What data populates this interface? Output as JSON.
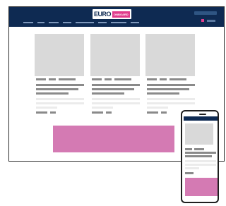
{
  "desktop": {
    "logo_text": "EURO",
    "logo_tag": "ONBOARD"
  },
  "colors": {
    "header": "#0e2a52",
    "accent": "#e03c8c",
    "banner": "#d47ab3",
    "placeholder": "#d9d9d9"
  },
  "icons": {
    "cart": "cart-icon",
    "account": "account-icon",
    "search": "search-icon"
  }
}
